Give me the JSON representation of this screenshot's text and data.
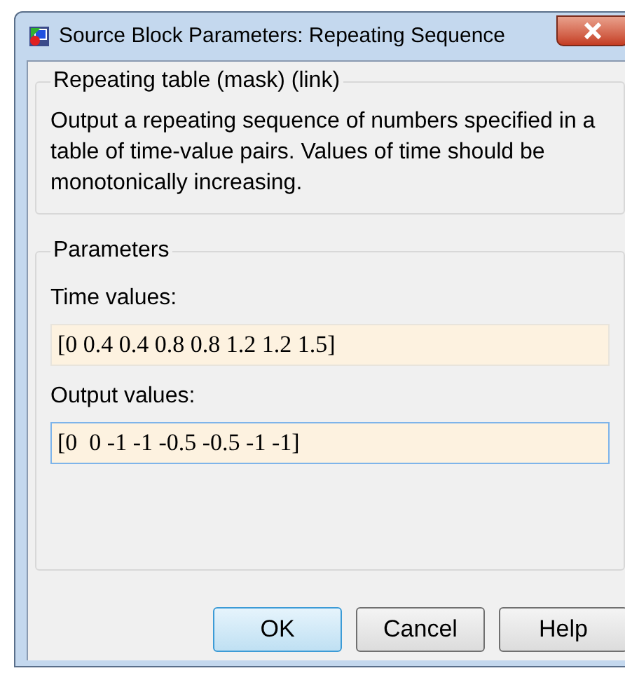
{
  "window": {
    "title": "Source Block Parameters: Repeating Sequence"
  },
  "description_group": {
    "title": "Repeating table (mask) (link)",
    "text": "Output a repeating sequence of numbers specified in a table of time-value pairs. Values of time should be monotonically increasing."
  },
  "parameters_group": {
    "title": "Parameters",
    "fields": [
      {
        "label": "Time values:",
        "value": "[0 0.4 0.4 0.8 0.8 1.2 1.2 1.5]",
        "focused": false
      },
      {
        "label": "Output values:",
        "value": "[0  0 -1 -1 -0.5 -0.5 -1 -1]",
        "focused": true
      }
    ]
  },
  "buttons": [
    {
      "label": "OK",
      "default": true
    },
    {
      "label": "Cancel",
      "default": false
    },
    {
      "label": "Help",
      "default": false
    }
  ]
}
